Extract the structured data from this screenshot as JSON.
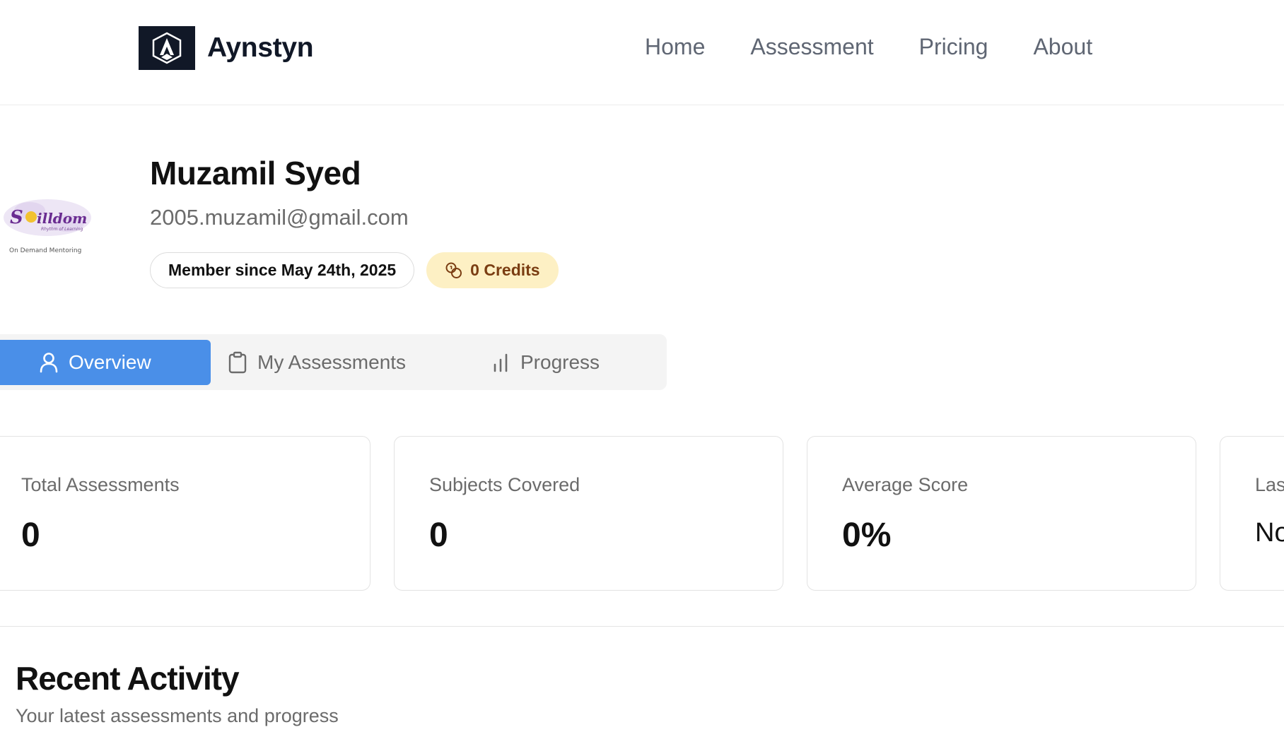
{
  "header": {
    "brand_name": "Aynstyn",
    "nav": [
      "Home",
      "Assessment",
      "Pricing",
      "About"
    ]
  },
  "profile": {
    "name": "Muzamil Syed",
    "email": "2005.muzamil@gmail.com",
    "member_since": "Member since May 24th, 2025",
    "credits": "0 Credits",
    "avatar": {
      "brand_text": "Skilldom",
      "tagline": "Rhythm of Learning",
      "subtext": "On Demand Mentoring"
    }
  },
  "tabs": {
    "overview": "Overview",
    "assessments": "My Assessments",
    "progress": "Progress"
  },
  "stats": [
    {
      "label": "Total Assessments",
      "value": "0"
    },
    {
      "label": "Subjects Covered",
      "value": "0"
    },
    {
      "label": "Average Score",
      "value": "0%"
    },
    {
      "label": "Las",
      "value": "No"
    }
  ],
  "recent": {
    "title": "Recent Activity",
    "subtitle": "Your latest assessments and progress"
  },
  "colors": {
    "accent": "#4a8fe8",
    "credits_bg": "#fdf0c4",
    "credits_text": "#7a3d12",
    "brand_dark": "#111827"
  }
}
